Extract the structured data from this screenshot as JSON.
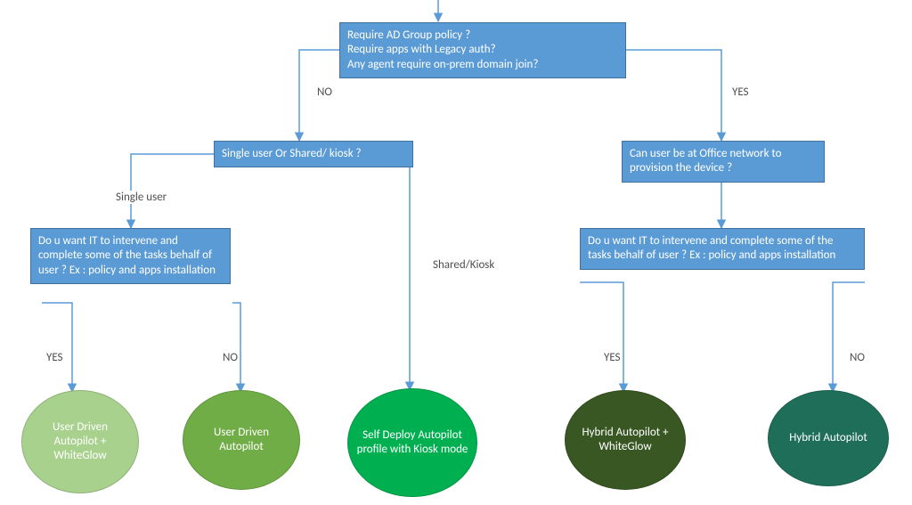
{
  "chart_data": {
    "type": "flowchart",
    "nodes": {
      "root": {
        "lines": [
          "Require AD Group policy ?",
          "Require apps with Legacy auth?",
          "Any agent require on-prem domain join?"
        ]
      },
      "singleOrShared": {
        "text": "Single user Or Shared/ kiosk ?"
      },
      "officeNetwork": {
        "text": "Can user   be at Office network to provision the device ?"
      },
      "itInterveneLeft": {
        "text": "Do u want IT to intervene and complete some of the tasks behalf of user ? Ex : policy and apps installation"
      },
      "itInterveneRight": {
        "text": "Do u want IT to intervene and complete some of the tasks behalf of user ? Ex : policy and apps installation"
      },
      "e1": {
        "text": "User Driven Autopilot + WhiteGlow",
        "fill": "#a9d18e"
      },
      "e2": {
        "text": "User Driven Autopilot",
        "fill": "#70ad47"
      },
      "e3": {
        "text": "Self Deploy Autopilot profile with Kiosk mode",
        "fill": "#00b050"
      },
      "e4": {
        "text": "Hybrid Autopilot + WhiteGlow",
        "fill": "#385723"
      },
      "e5": {
        "text": "Hybrid Autopilot",
        "fill": "#1f6e59"
      }
    },
    "edgeLabels": {
      "rootNo": "NO",
      "rootYes": "YES",
      "singleUser": "Single user",
      "sharedKiosk": "Shared/Kiosk",
      "leftYes": "YES",
      "leftNo": "NO",
      "rightYes": "YES",
      "rightNo": "NO"
    },
    "colors": {
      "decisionFill": "#5b9bd5",
      "decisionStroke": "#41719c",
      "connector": "#5b9bd5"
    }
  }
}
